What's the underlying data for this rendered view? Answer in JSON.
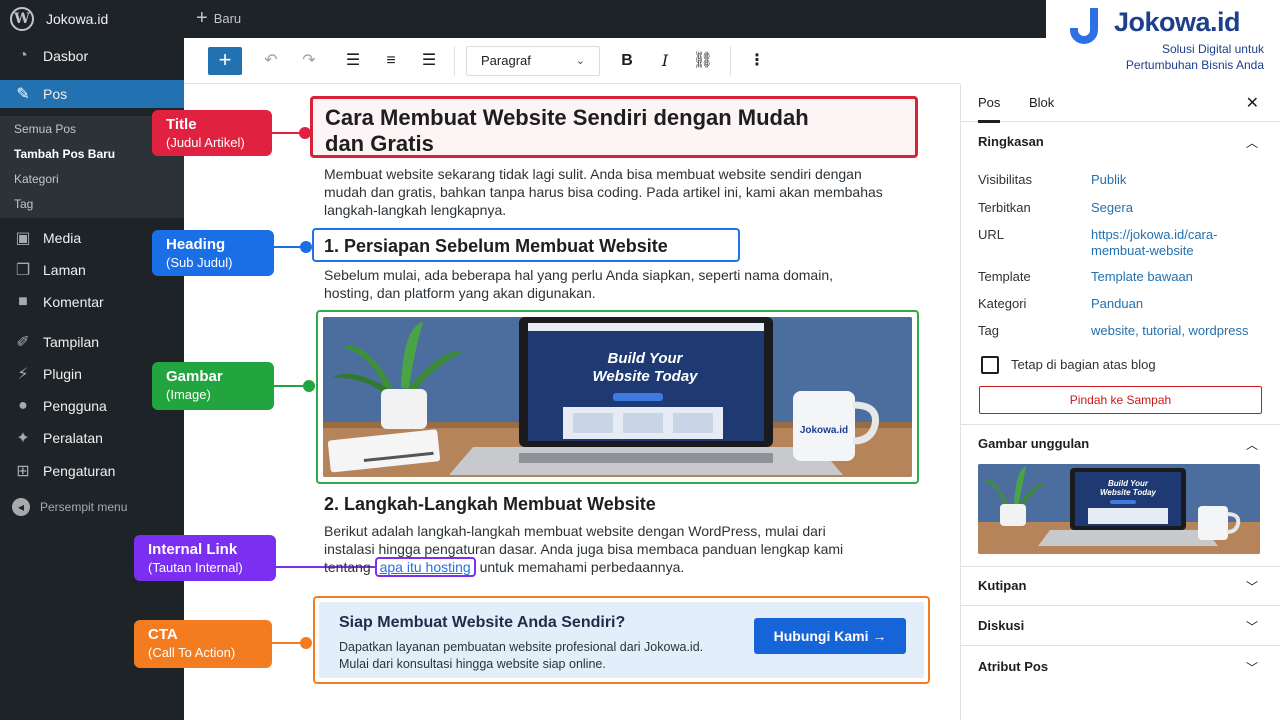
{
  "adminbar": {
    "site_name": "Jokowa.id",
    "new_label": "Baru"
  },
  "brand": {
    "name": "Jokowa.id",
    "tagline_1": "Solusi Digital untuk",
    "tagline_2": "Pertumbuhan Bisnis Anda",
    "color": "#1d3f8c"
  },
  "sidebar": {
    "items": [
      {
        "label": "Dasbor",
        "icon": "dashboard-icon"
      },
      {
        "label": "Pos",
        "icon": "pin-icon",
        "active": true
      },
      {
        "label": "Media",
        "icon": "media-icon"
      },
      {
        "label": "Laman",
        "icon": "pages-icon"
      },
      {
        "label": "Komentar",
        "icon": "comment-icon"
      },
      {
        "label": "Tampilan",
        "icon": "brush-icon"
      },
      {
        "label": "Plugin",
        "icon": "plugin-icon"
      },
      {
        "label": "Pengguna",
        "icon": "user-icon"
      },
      {
        "label": "Peralatan",
        "icon": "wrench-icon"
      },
      {
        "label": "Pengaturan",
        "icon": "settings-icon"
      }
    ],
    "submenu": [
      "Semua Pos",
      "Tambah Pos Baru",
      "Kategori",
      "Tag"
    ],
    "collapse_label": "Persempit menu"
  },
  "toolbar": {
    "block_type": "Paragraf"
  },
  "callouts": [
    {
      "title": "Title",
      "subtitle": "(Judul Artikel)",
      "color": "#e0213f"
    },
    {
      "title": "Heading",
      "subtitle": "(Sub Judul)",
      "color": "#1a6ee6"
    },
    {
      "title": "Gambar",
      "subtitle": "(Image)",
      "color": "#22a43f"
    },
    {
      "title": "Internal Link",
      "subtitle": "(Tautan Internal)",
      "color": "#7b2ff0"
    },
    {
      "title": "CTA",
      "subtitle": "(Call To Action)",
      "color": "#f47c20"
    }
  ],
  "post": {
    "title_line1": "Cara Membuat Website Sendiri dengan Mudah",
    "title_line2": "dan Gratis",
    "intro_l1": "Membuat website sekarang tidak lagi sulit. Anda bisa membuat website sendiri dengan",
    "intro_l2": "mudah dan gratis, bahkan tanpa harus bisa coding. Pada artikel ini, kami akan membahas",
    "intro_l3": "langkah-langkah lengkapnya.",
    "h1": "1. Persiapan Sebelum Membuat Website",
    "p1_l1": "Sebelum mulai, ada beberapa hal yang perlu Anda siapkan, seperti nama domain,",
    "p1_l2": "hosting, dan platform yang akan digunakan.",
    "image_text_1": "Build Your",
    "image_text_2": "Website Today",
    "mug_text": "Jokowa.id",
    "h2": "2. Langkah-Langkah Membuat Website",
    "p2_l1": "Berikut adalah langkah-langkah membuat website dengan WordPress, mulai dari",
    "p2_l2": "instalasi hingga pengaturan dasar. Anda juga bisa membaca panduan lengkap kami",
    "p2_l3_pre": "tentang",
    "p2_link": "apa itu hosting",
    "p2_l3_post": "untuk memahami perbedaannya."
  },
  "cta": {
    "title": "Siap Membuat Website Anda Sendiri?",
    "desc_1": "Dapatkan layanan pembuatan website profesional dari Jokowa.id.",
    "desc_2": "Mulai dari konsultasi hingga website siap online.",
    "button": "Hubungi Kami →"
  },
  "panel": {
    "tab_post": "Pos",
    "tab_block": "Blok",
    "summary_title": "Ringkasan",
    "rows": [
      {
        "label": "Visibilitas",
        "value": "Publik"
      },
      {
        "label": "Terbitkan",
        "value": "Segera"
      },
      {
        "label": "URL",
        "value_1": "https://jokowa.id/cara-",
        "value_2": "membuat-website"
      },
      {
        "label": "Template",
        "value": "Template bawaan"
      },
      {
        "label": "Kategori",
        "value": "Panduan"
      },
      {
        "label": "Tag",
        "value": "website, tutorial, wordpress"
      }
    ],
    "sticky_label": "Tetap di bagian atas blog",
    "trash_label": "Pindah ke Sampah",
    "featured_title": "Gambar unggulan",
    "featured_text_1": "Build Your",
    "featured_text_2": "Website Today",
    "sections": [
      "Kutipan",
      "Diskusi",
      "Atribut Pos"
    ]
  }
}
